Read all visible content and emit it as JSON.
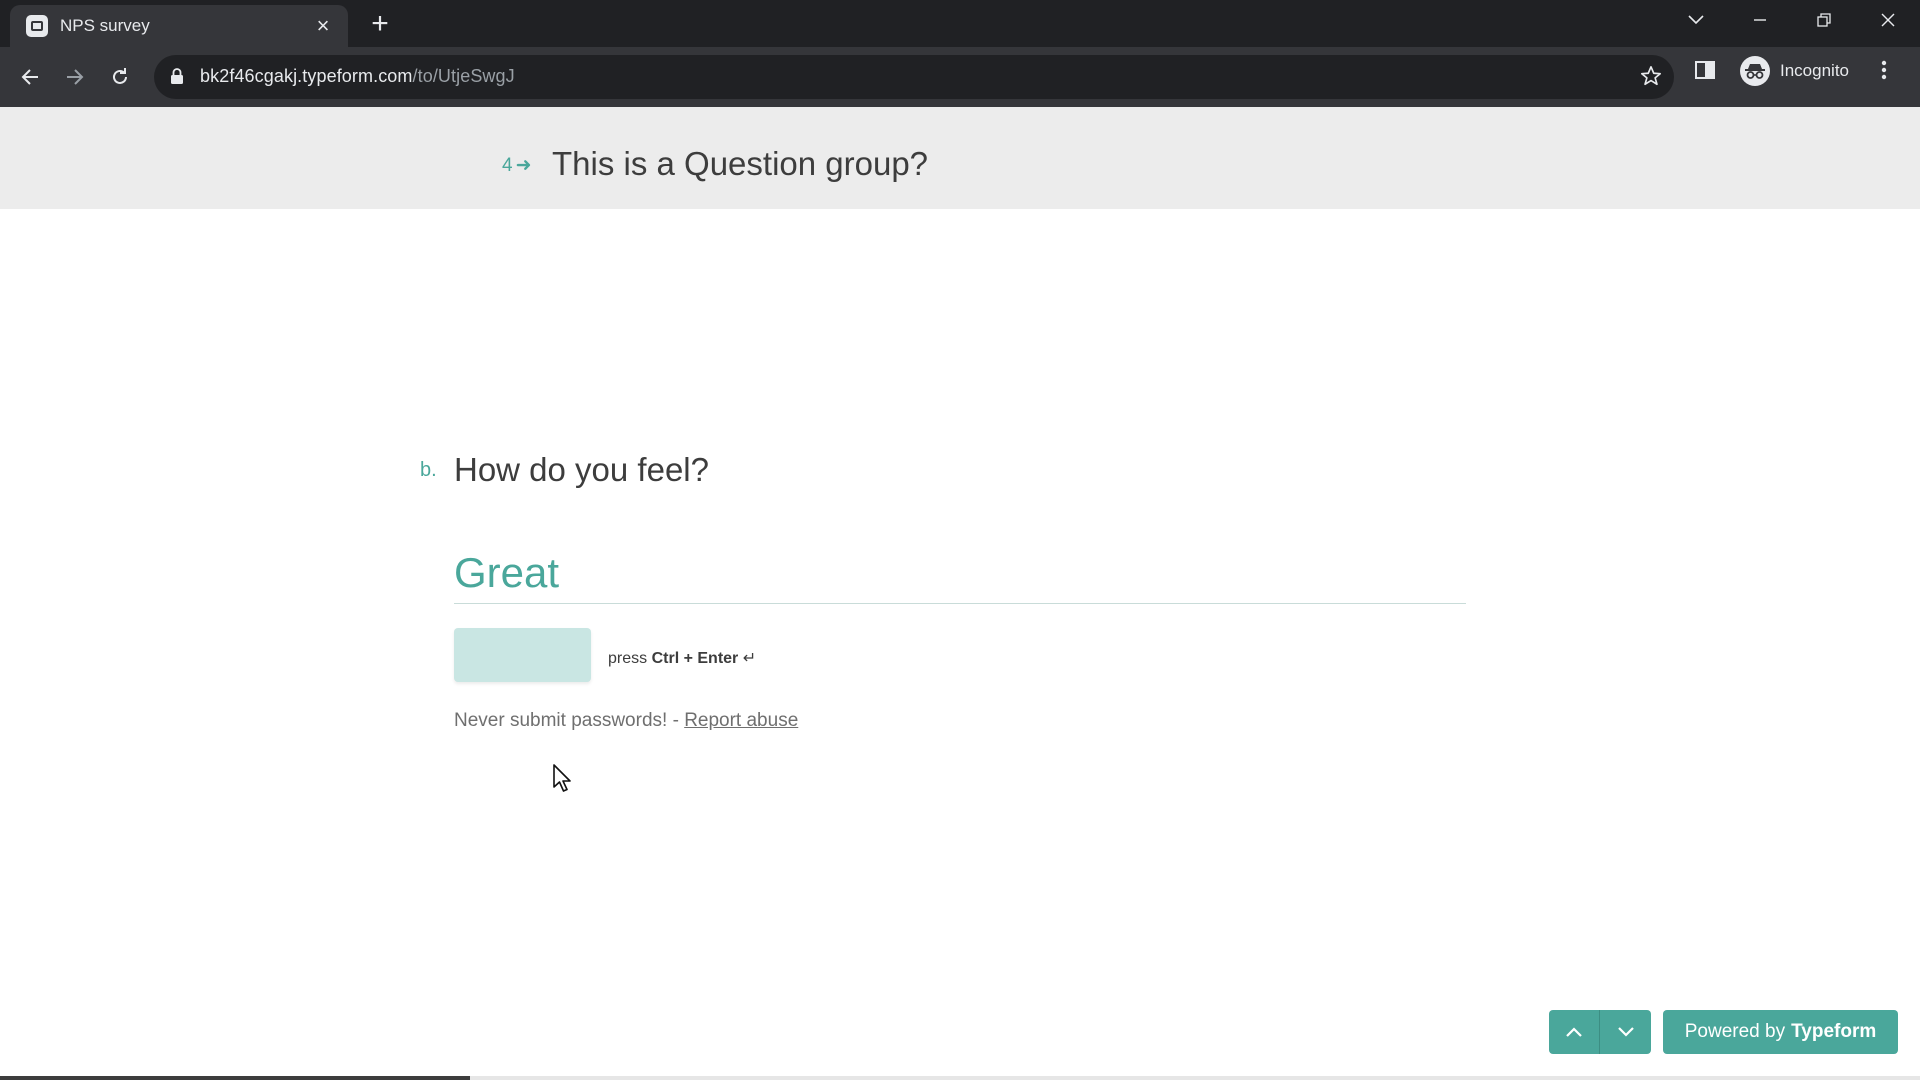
{
  "browser": {
    "tab_title": "NPS survey",
    "url_host": "bk2f46cgakj.typeform.com",
    "url_path": "/to/UtjeSwgJ",
    "profile_label": "Incognito"
  },
  "group": {
    "number": "4",
    "title": "This is a Question group?"
  },
  "question": {
    "letter": "b.",
    "title": "How do you feel?",
    "answer_value": "Great"
  },
  "submit": {
    "hint_prefix": "press",
    "hint_keys": "Ctrl + Enter",
    "hint_symbol": "↵"
  },
  "footer": {
    "warning": "Never submit passwords! -",
    "report_link": "Report abuse",
    "powered_prefix": "Powered by",
    "powered_brand": "Typeform"
  },
  "progress": {
    "fraction": 0.245
  },
  "colors": {
    "accent": "#4aa79b",
    "chrome_dark": "#202124",
    "chrome_mid": "#35363a"
  }
}
